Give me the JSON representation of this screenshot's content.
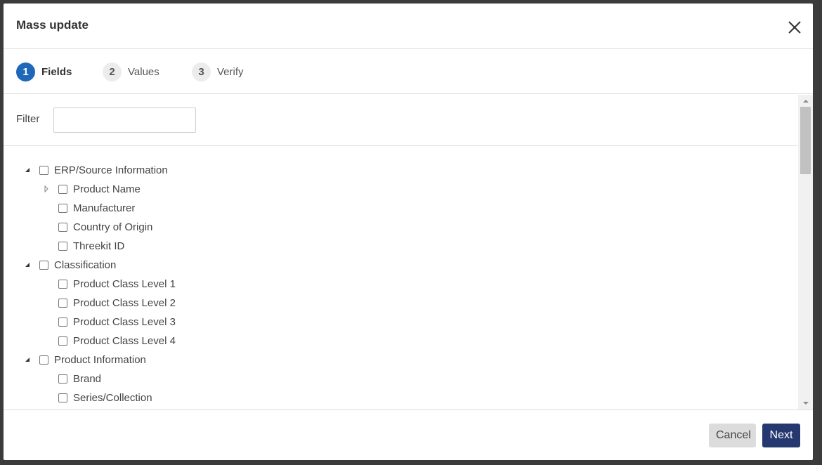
{
  "dialog": {
    "title": "Mass update",
    "close_icon": "close-icon"
  },
  "steps": [
    {
      "number": "1",
      "label": "Fields",
      "active": true
    },
    {
      "number": "2",
      "label": "Values",
      "active": false
    },
    {
      "number": "3",
      "label": "Verify",
      "active": false
    }
  ],
  "filter": {
    "label": "Filter",
    "value": "",
    "placeholder": ""
  },
  "tree": [
    {
      "label": "ERP/Source Information",
      "level": 0,
      "toggle": "expanded",
      "checked": false
    },
    {
      "label": "Product Name",
      "level": 1,
      "toggle": "collapsed",
      "checked": false
    },
    {
      "label": "Manufacturer",
      "level": 1,
      "toggle": "none",
      "checked": false
    },
    {
      "label": "Country of Origin",
      "level": 1,
      "toggle": "none",
      "checked": false
    },
    {
      "label": "Threekit ID",
      "level": 1,
      "toggle": "none",
      "checked": false
    },
    {
      "label": "Classification",
      "level": 0,
      "toggle": "expanded",
      "checked": false
    },
    {
      "label": "Product Class Level 1",
      "level": 1,
      "toggle": "none",
      "checked": false
    },
    {
      "label": "Product Class Level 2",
      "level": 1,
      "toggle": "none",
      "checked": false
    },
    {
      "label": "Product Class Level 3",
      "level": 1,
      "toggle": "none",
      "checked": false
    },
    {
      "label": "Product Class Level 4",
      "level": 1,
      "toggle": "none",
      "checked": false
    },
    {
      "label": "Product Information",
      "level": 0,
      "toggle": "expanded",
      "checked": false
    },
    {
      "label": "Brand",
      "level": 1,
      "toggle": "none",
      "checked": false
    },
    {
      "label": "Series/Collection",
      "level": 1,
      "toggle": "none",
      "checked": false
    }
  ],
  "footer": {
    "cancel_label": "Cancel",
    "next_label": "Next"
  },
  "colors": {
    "step_active": "#1f68b9",
    "primary_button": "#25386f",
    "secondary_button": "#dcdcdc"
  }
}
